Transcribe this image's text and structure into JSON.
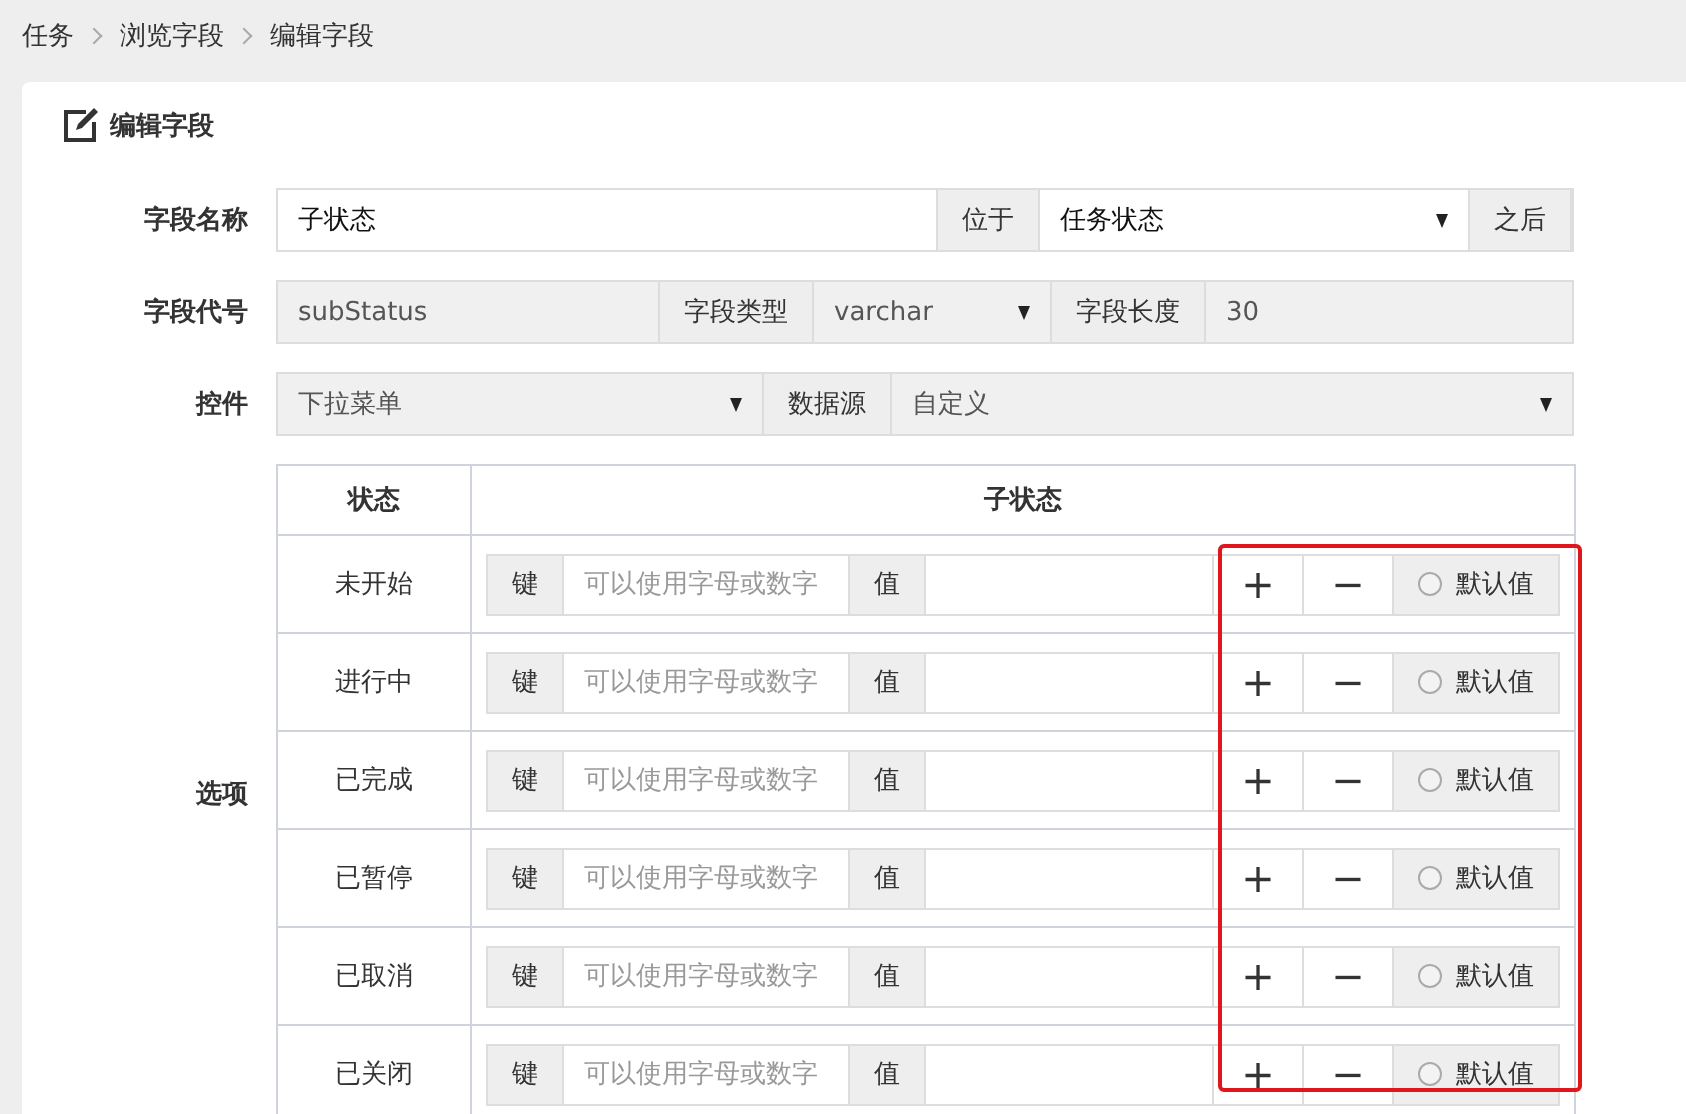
{
  "breadcrumb": [
    "任务",
    "浏览字段",
    "编辑字段"
  ],
  "panel_title": "编辑字段",
  "name_row": {
    "label": "字段名称",
    "value": "子状态",
    "disabled": false,
    "position_label": "位于",
    "position_value": "任务状态",
    "position_disabled": false,
    "after_label": "之后"
  },
  "code_row": {
    "label": "字段代号",
    "value": "subStatus",
    "disabled": true,
    "type_label": "字段类型",
    "type_value": "varchar",
    "type_disabled": true,
    "length_label": "字段长度",
    "length_value": "30",
    "length_disabled": true
  },
  "control_row": {
    "label": "控件",
    "value": "下拉菜单",
    "disabled": true,
    "source_label": "数据源",
    "source_value": "自定义",
    "source_disabled": true
  },
  "options": {
    "label": "选项",
    "columns": [
      "状态",
      "子状态"
    ],
    "highlighted": true,
    "rows": [
      {
        "state": "未开始",
        "key_label": "键",
        "key_placeholder": "可以使用字母或数字",
        "value_label": "值",
        "add": "+",
        "remove": "−",
        "default_label": "默认值",
        "default_checked": false
      },
      {
        "state": "进行中",
        "key_label": "键",
        "key_placeholder": "可以使用字母或数字",
        "value_label": "值",
        "add": "+",
        "remove": "−",
        "default_label": "默认值",
        "default_checked": false
      },
      {
        "state": "已完成",
        "key_label": "键",
        "key_placeholder": "可以使用字母或数字",
        "value_label": "值",
        "add": "+",
        "remove": "−",
        "default_label": "默认值",
        "default_checked": false
      },
      {
        "state": "已暂停",
        "key_label": "键",
        "key_placeholder": "可以使用字母或数字",
        "value_label": "值",
        "add": "+",
        "remove": "−",
        "default_label": "默认值",
        "default_checked": false
      },
      {
        "state": "已取消",
        "key_label": "键",
        "key_placeholder": "可以使用字母或数字",
        "value_label": "值",
        "add": "+",
        "remove": "−",
        "default_label": "默认值",
        "default_checked": false
      },
      {
        "state": "已关闭",
        "key_label": "键",
        "key_placeholder": "可以使用字母或数字",
        "value_label": "值",
        "add": "+",
        "remove": "−",
        "default_label": "默认值",
        "default_checked": false
      }
    ]
  }
}
